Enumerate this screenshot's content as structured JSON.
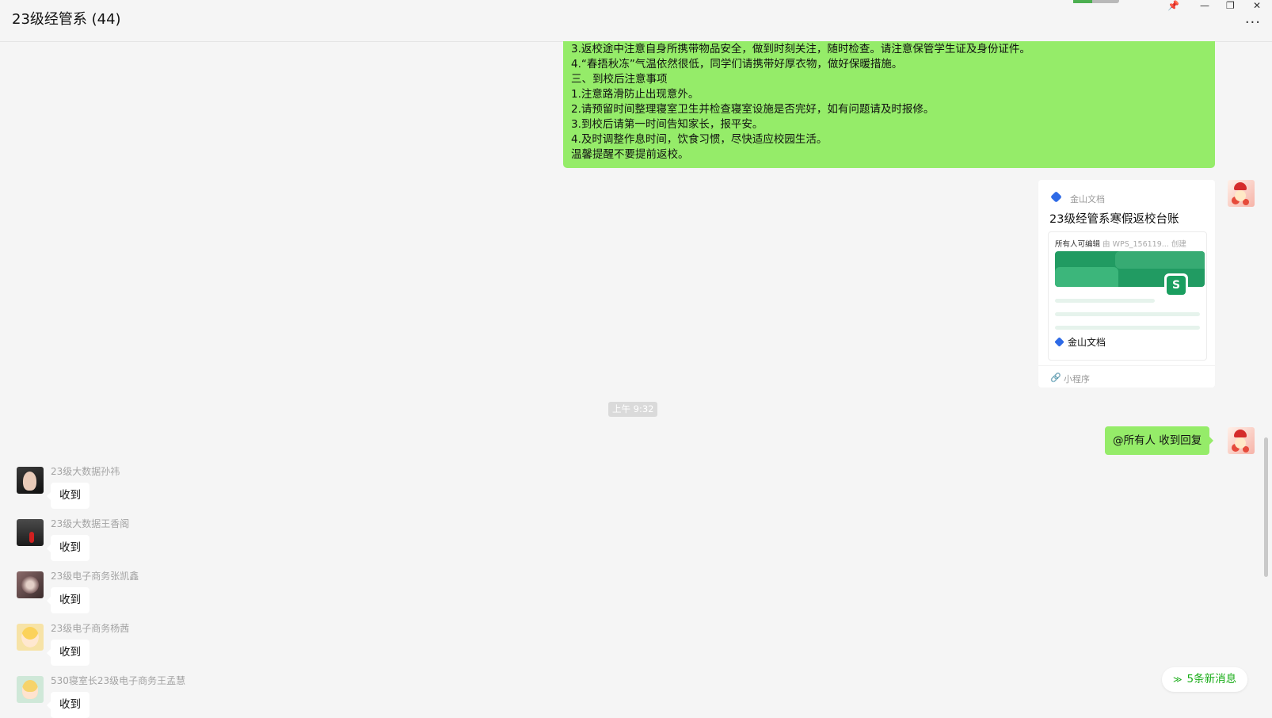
{
  "window": {
    "title": "23级经管系 (44)",
    "controls": {
      "pin": "📌",
      "minimize": "—",
      "restore": "❐",
      "close": "✕"
    },
    "more": "···"
  },
  "announcement_lines": [
    "3.返校途中注意自身所携带物品安全，做到时刻关注，随时检查。请注意保管学生证及身份证件。",
    "4.“春捂秋冻”气温依然很低，同学们请携带好厚衣物，做好保暖措施。",
    "三、到校后注意事项",
    "1.注意路滑防止出现意外。",
    "2.请预留时间整理寝室卫生并检查寝室设施是否完好，如有问题请及时报修。",
    "3.到校后请第一时间告知家长，报平安。",
    "4.及时调整作息时间，饮食习惯，尽快适应校园生活。",
    "温馨提醒不要提前返校。"
  ],
  "card": {
    "source": "金山文档",
    "title": "23级经管系寒假返校台账",
    "meta_editable": "所有人可编辑",
    "meta_by": "由",
    "meta_creator": "WPS_156119...",
    "meta_action": "创建",
    "s_letter": "S",
    "footer_brand": "金山文档",
    "type_label": "小程序",
    "type_icon": "🔗"
  },
  "timestamp": "上午 9:32",
  "my_message": "@所有人 收到回复",
  "messages": [
    {
      "sender": "23级大数据孙祎",
      "text": "收到"
    },
    {
      "sender": "23级大数据王香阁",
      "text": "收到"
    },
    {
      "sender": "23级电子商务张凯鑫",
      "text": "收到"
    },
    {
      "sender": "23级电子商务杨茜",
      "text": "收到"
    },
    {
      "sender": "530寝室长23级电子商务王孟慧",
      "text": "收到"
    }
  ],
  "new_messages": {
    "icon": "≫",
    "label": "5条新消息"
  },
  "colors": {
    "my_bubble": "#95ec69",
    "background": "#f5f5f5",
    "new_msg_text": "#1aad19"
  }
}
